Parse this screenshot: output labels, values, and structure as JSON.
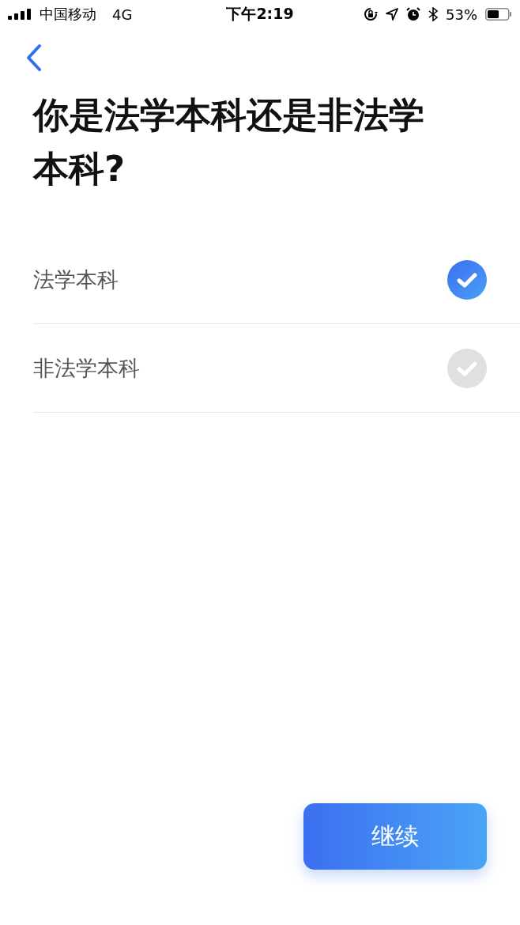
{
  "status_bar": {
    "carrier": "中国移动",
    "network": "4G",
    "time": "下午2:19",
    "battery": "53%"
  },
  "title": "你是法学本科还是非法学本科?",
  "options": [
    {
      "label": "法学本科",
      "selected": true
    },
    {
      "label": "非法学本科",
      "selected": false
    }
  ],
  "continue_button": "继续"
}
